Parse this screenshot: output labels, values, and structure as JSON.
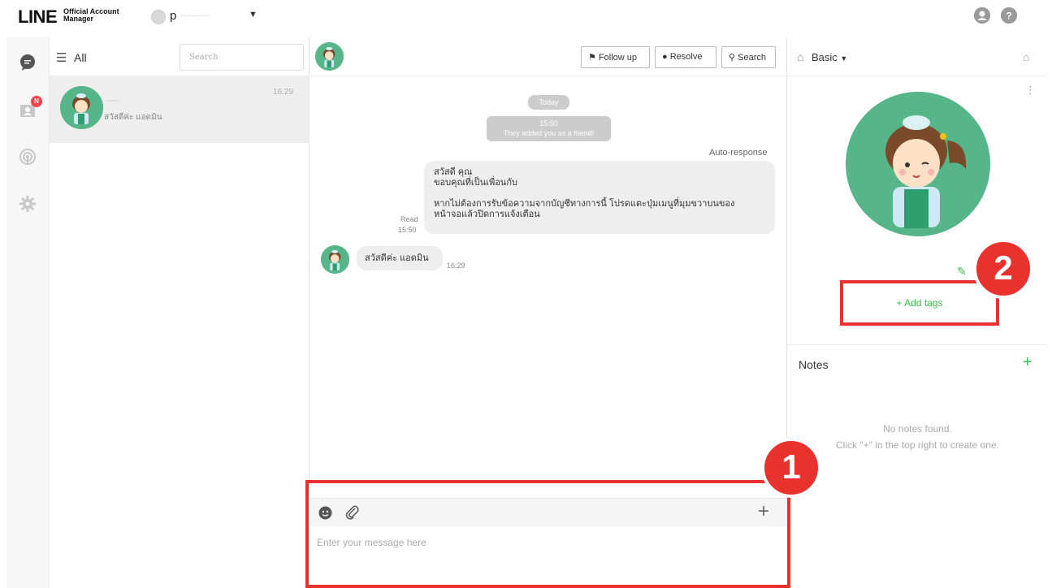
{
  "brand": {
    "logo_main": "LINE",
    "logo_sub_1": "Official Account",
    "logo_sub_2": "Manager"
  },
  "account": {
    "name": "p",
    "name_rest": "················",
    "caret": "▼"
  },
  "top_icons": [
    "user-icon",
    "help-icon"
  ],
  "left_nav": {
    "items": [
      "chat-icon",
      "contacts-icon",
      "broadcast-icon",
      "settings-icon"
    ],
    "badge": "N"
  },
  "chat_list": {
    "filter_label": "All",
    "search_placeholder": "Search",
    "rows": [
      {
        "name": "·······",
        "preview": "สวัสดีค่ะ แอดมิน",
        "time": "16:29"
      }
    ]
  },
  "conversation": {
    "buttons": {
      "follow_up": "Follow up",
      "resolve": "Resolve",
      "search": "Search"
    },
    "date_pill": "Today",
    "system_time": "15:50",
    "system_text": "They added you as a friend!",
    "auto_response_label": "Auto-response",
    "auto_message_lines": [
      "สวัสดี คุณ",
      "ขอบคุณที่เป็นเพื่อนกับ",
      "",
      "หากไม่ต้องการรับข้อความจากบัญชีทางการนี้ โปรดแตะปุ่มเมนูที่มุมขวาบนของ",
      "หน้าจอแล้วปิดการแจ้งเตือน"
    ],
    "read_label": "Read",
    "read_time": "15:50",
    "user_message": "สวัสดีค่ะ แอดมิน",
    "user_message_time": "16:29",
    "composer_placeholder": "Enter your message here"
  },
  "profile": {
    "plan_label": "Basic",
    "add_tags_label": "+ Add tags",
    "notes_title": "Notes",
    "notes_empty_line1": "No notes found.",
    "notes_empty_line2": "Click \"+\" in the top right to create one."
  },
  "annotations": {
    "marker_1": "1",
    "marker_2": "2"
  },
  "colors": {
    "accent_green": "#3ac14a",
    "avatar_green": "#57b58a",
    "annotation_red": "#e7322e",
    "badge_red": "#f0434a"
  }
}
